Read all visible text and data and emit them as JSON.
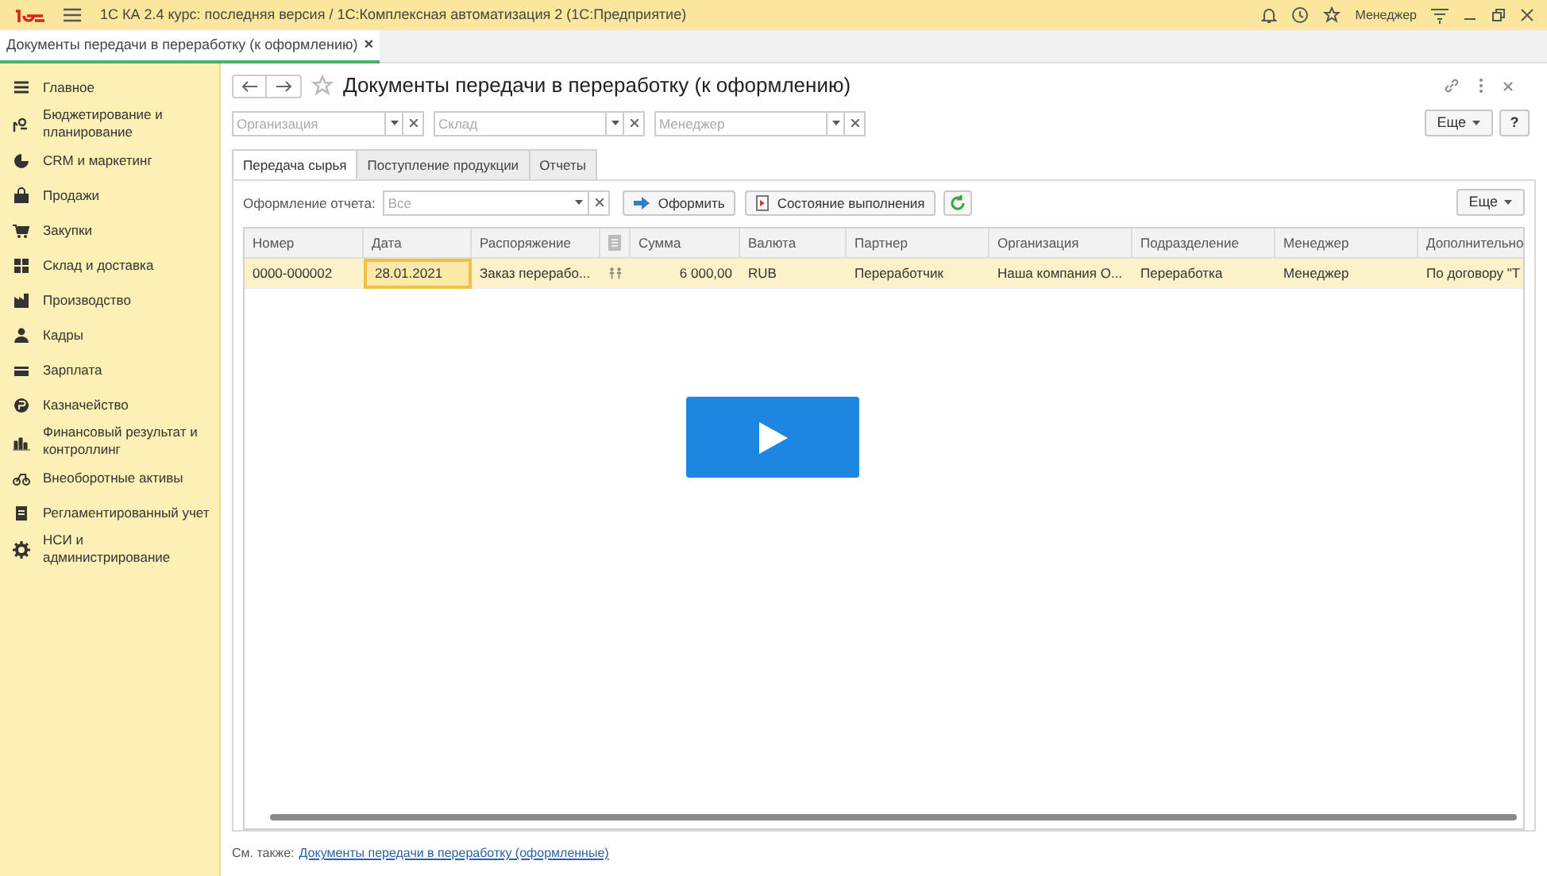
{
  "title_bar": {
    "title": "1С КА 2.4 курс: последняя версия / 1С:Комплексная автоматизация 2  (1С:Предприятие)",
    "user": "Менеджер"
  },
  "open_tabs": [
    {
      "label": "Документы передачи в переработку (к оформлению)",
      "close": "×",
      "selected": true
    }
  ],
  "sidebar": {
    "items": [
      {
        "label": "Главное",
        "kind": "menu"
      },
      {
        "label": "Бюджетирование и планирование",
        "kind": "budget"
      },
      {
        "label": "CRM и маркетинг",
        "kind": "pie"
      },
      {
        "label": "Продажи",
        "kind": "bag"
      },
      {
        "label": "Закупки",
        "kind": "cart"
      },
      {
        "label": "Склад и доставка",
        "kind": "grid"
      },
      {
        "label": "Производство",
        "kind": "factory"
      },
      {
        "label": "Кадры",
        "kind": "person"
      },
      {
        "label": "Зарплата",
        "kind": "card"
      },
      {
        "label": "Казначейство",
        "kind": "coin"
      },
      {
        "label": "Финансовый результат и контроллинг",
        "kind": "bars"
      },
      {
        "label": "Внеоборотные активы",
        "kind": "bike"
      },
      {
        "label": "Регламентированный учет",
        "kind": "doc"
      },
      {
        "label": "НСИ и администрирование",
        "kind": "gear"
      }
    ]
  },
  "form": {
    "title": "Документы передачи в переработку (к оформлению)",
    "filters": [
      {
        "placeholder": "Организация"
      },
      {
        "placeholder": "Склад"
      },
      {
        "placeholder": "Менеджер"
      }
    ],
    "more_button": "Еще",
    "help_button": "?",
    "tabs": [
      {
        "label": "Передача сырья",
        "selected": true
      },
      {
        "label": "Поступление продукции",
        "selected": false
      },
      {
        "label": "Отчеты",
        "selected": false
      }
    ],
    "report_filter": {
      "label": "Оформление отчета:",
      "value": "Все"
    },
    "buttons": [
      {
        "label": "Оформить",
        "kind": "arrow"
      },
      {
        "label": "Состояние выполнения",
        "kind": "report"
      }
    ],
    "table_more_button": "Еще",
    "table": {
      "columns": [
        "Номер",
        "Дата",
        "Распоряжение",
        "",
        "Сумма",
        "Валюта",
        "Партнер",
        "Организация",
        "Подразделение",
        "Менеджер",
        "Дополнительно"
      ],
      "rows": [
        {
          "selected": true,
          "cells": [
            "0000-000002",
            "28.01.2021",
            "Заказ перерабо...",
            "",
            "6 000,00",
            "RUB",
            "Переработчик",
            "Наша компания О...",
            "Переработка",
            "Менеджер",
            "По договору \"Т"
          ]
        }
      ]
    },
    "see_also": {
      "label": "См. также:",
      "link": "Документы передачи в переработку (оформленные)"
    }
  }
}
